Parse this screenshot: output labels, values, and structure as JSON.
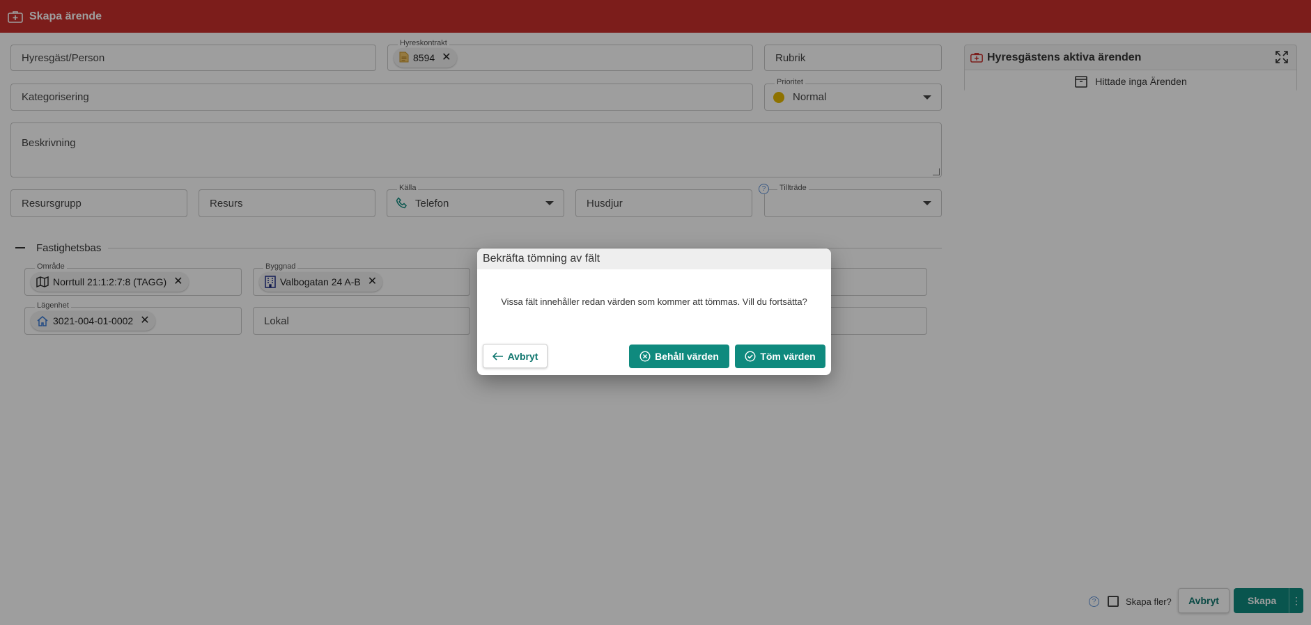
{
  "app": {
    "title": "Skapa ärende",
    "title_icon": "medical-case-icon"
  },
  "form": {
    "tenant": {
      "placeholder": "Hyresgäst/Person"
    },
    "contract": {
      "label": "Hyreskontrakt",
      "chip": "8594"
    },
    "subject": {
      "placeholder": "Rubrik"
    },
    "category": {
      "placeholder": "Kategorisering"
    },
    "priority": {
      "label": "Prioritet",
      "value": "Normal",
      "color": "#e6b800"
    },
    "description": {
      "placeholder": "Beskrivning"
    },
    "resource_group": {
      "placeholder": "Resursgrupp"
    },
    "resource": {
      "placeholder": "Resurs"
    },
    "source": {
      "label": "Källa",
      "value": "Telefon"
    },
    "pet": {
      "placeholder": "Husdjur"
    },
    "access": {
      "label": "Tillträde",
      "value": ""
    }
  },
  "property": {
    "section_title": "Fastighetsbas",
    "area": {
      "label": "Område",
      "chip": "Norrtull 21:1:2:7:8 (TAGG)"
    },
    "building": {
      "label": "Byggnad",
      "chip": "Valbogatan 24 A-B"
    },
    "apartment": {
      "label": "Lägenhet",
      "chip": "3021-004-01-0002"
    },
    "premises": {
      "placeholder": "Lokal"
    }
  },
  "aside": {
    "title": "Hyresgästens aktiva ärenden",
    "empty_text": "Hittade inga Ärenden"
  },
  "dialog": {
    "title": "Bekräfta tömning av fält",
    "message": "Vissa fält innehåller redan värden som kommer att tömmas. Vill du fortsätta?",
    "cancel_label": "Avbryt",
    "keep_label": "Behåll värden",
    "clear_label": "Töm värden"
  },
  "footer": {
    "help": "?",
    "create_more_label": "Skapa fler?",
    "cancel_label": "Avbryt",
    "create_label": "Skapa",
    "more_icon": "⋮"
  },
  "colors": {
    "brand": "#c8302c",
    "primary": "#0f8a7e",
    "help_blue": "#5b8fd6"
  }
}
